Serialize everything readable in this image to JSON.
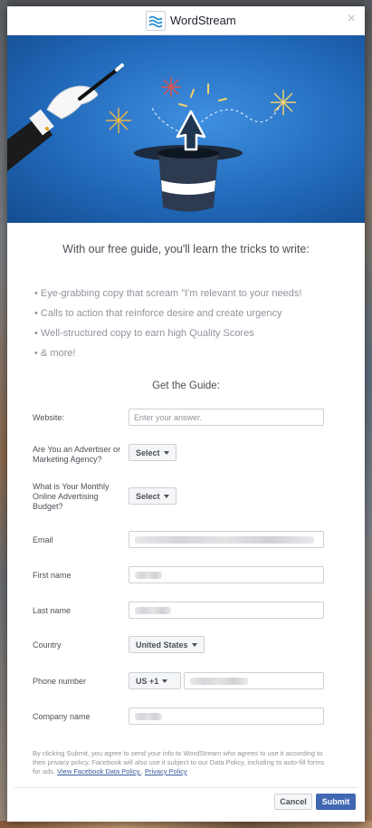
{
  "header": {
    "brand": "WordStream",
    "close_glyph": "×"
  },
  "intro": "With our free guide, you'll learn the tricks to write:",
  "bullets": [
    "Eye-grabbing copy that scream \"I'm relevant to your needs!",
    "Calls to action that reinforce desire and create urgency",
    "Well-structured copy to earn high Quality Scores",
    "& more!"
  ],
  "form": {
    "title": "Get the Guide:",
    "website_label": "Website:",
    "website_placeholder": "Enter your answer.",
    "advertiser_label": "Are You an Advertiser or Marketing Agency?",
    "advertiser_value": "Select",
    "budget_label": "What is Your Monthly Online Advertising Budget?",
    "budget_value": "Select",
    "email_label": "Email",
    "first_name_label": "First name",
    "last_name_label": "Last name",
    "country_label": "Country",
    "country_value": "United States",
    "phone_label": "Phone number",
    "phone_code": "US +1",
    "company_label": "Company name"
  },
  "disclaimer": {
    "text": "By clicking Submit, you agree to send your info to WordStream who agrees to use it according to their privacy policy. Facebook will also use it subject to our Data Policy, including to auto-fill forms for ads.",
    "link1": "View Facebook Data Policy.",
    "link2": "Privacy Policy"
  },
  "buttons": {
    "cancel": "Cancel",
    "submit": "Submit"
  },
  "colors": {
    "hero_blue": "#1f66b8",
    "submit_blue": "#4267b2",
    "logo_blue": "#2a8fd0"
  }
}
